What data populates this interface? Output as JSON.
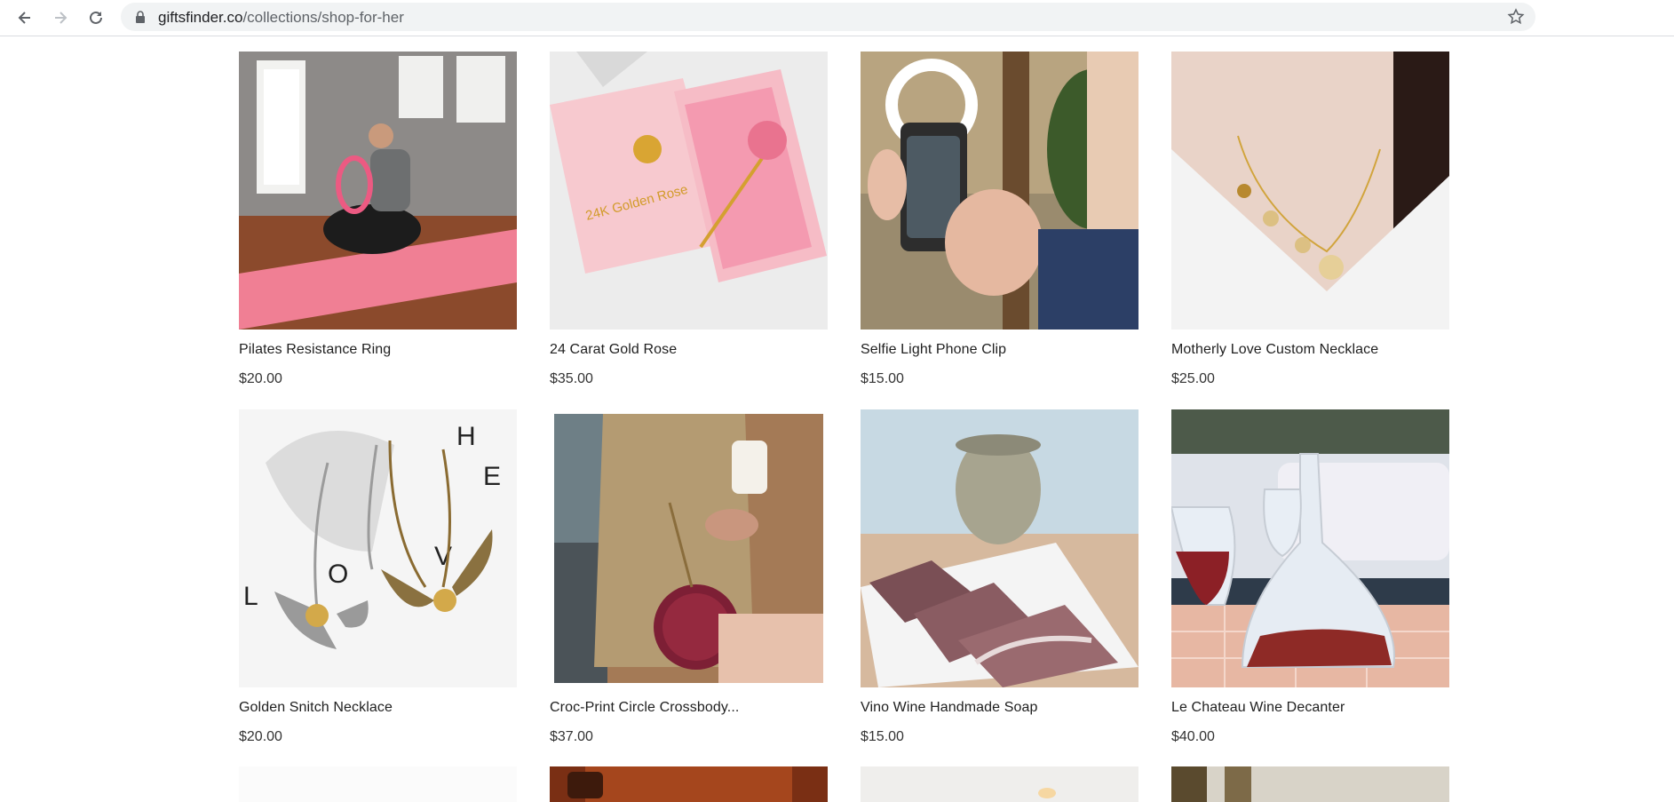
{
  "browser": {
    "url_domain": "giftsfinder.co",
    "url_path": "/collections/shop-for-her"
  },
  "products": [
    {
      "title": "Pilates Resistance Ring",
      "price": "$20.00"
    },
    {
      "title": "24 Carat Gold Rose",
      "price": "$35.00"
    },
    {
      "title": "Selfie Light Phone Clip",
      "price": "$15.00"
    },
    {
      "title": "Motherly Love Custom Necklace",
      "price": "$25.00"
    },
    {
      "title": "Golden Snitch Necklace",
      "price": "$20.00"
    },
    {
      "title": "Croc-Print Circle Crossbody...",
      "price": "$37.00"
    },
    {
      "title": "Vino Wine Handmade Soap",
      "price": "$15.00"
    },
    {
      "title": "Le Chateau Wine Decanter",
      "price": "$40.00"
    }
  ],
  "image_text": {
    "rose_box": "24K Golden Rose",
    "love_letters": [
      "H",
      "E",
      "L",
      "O",
      "V"
    ]
  }
}
